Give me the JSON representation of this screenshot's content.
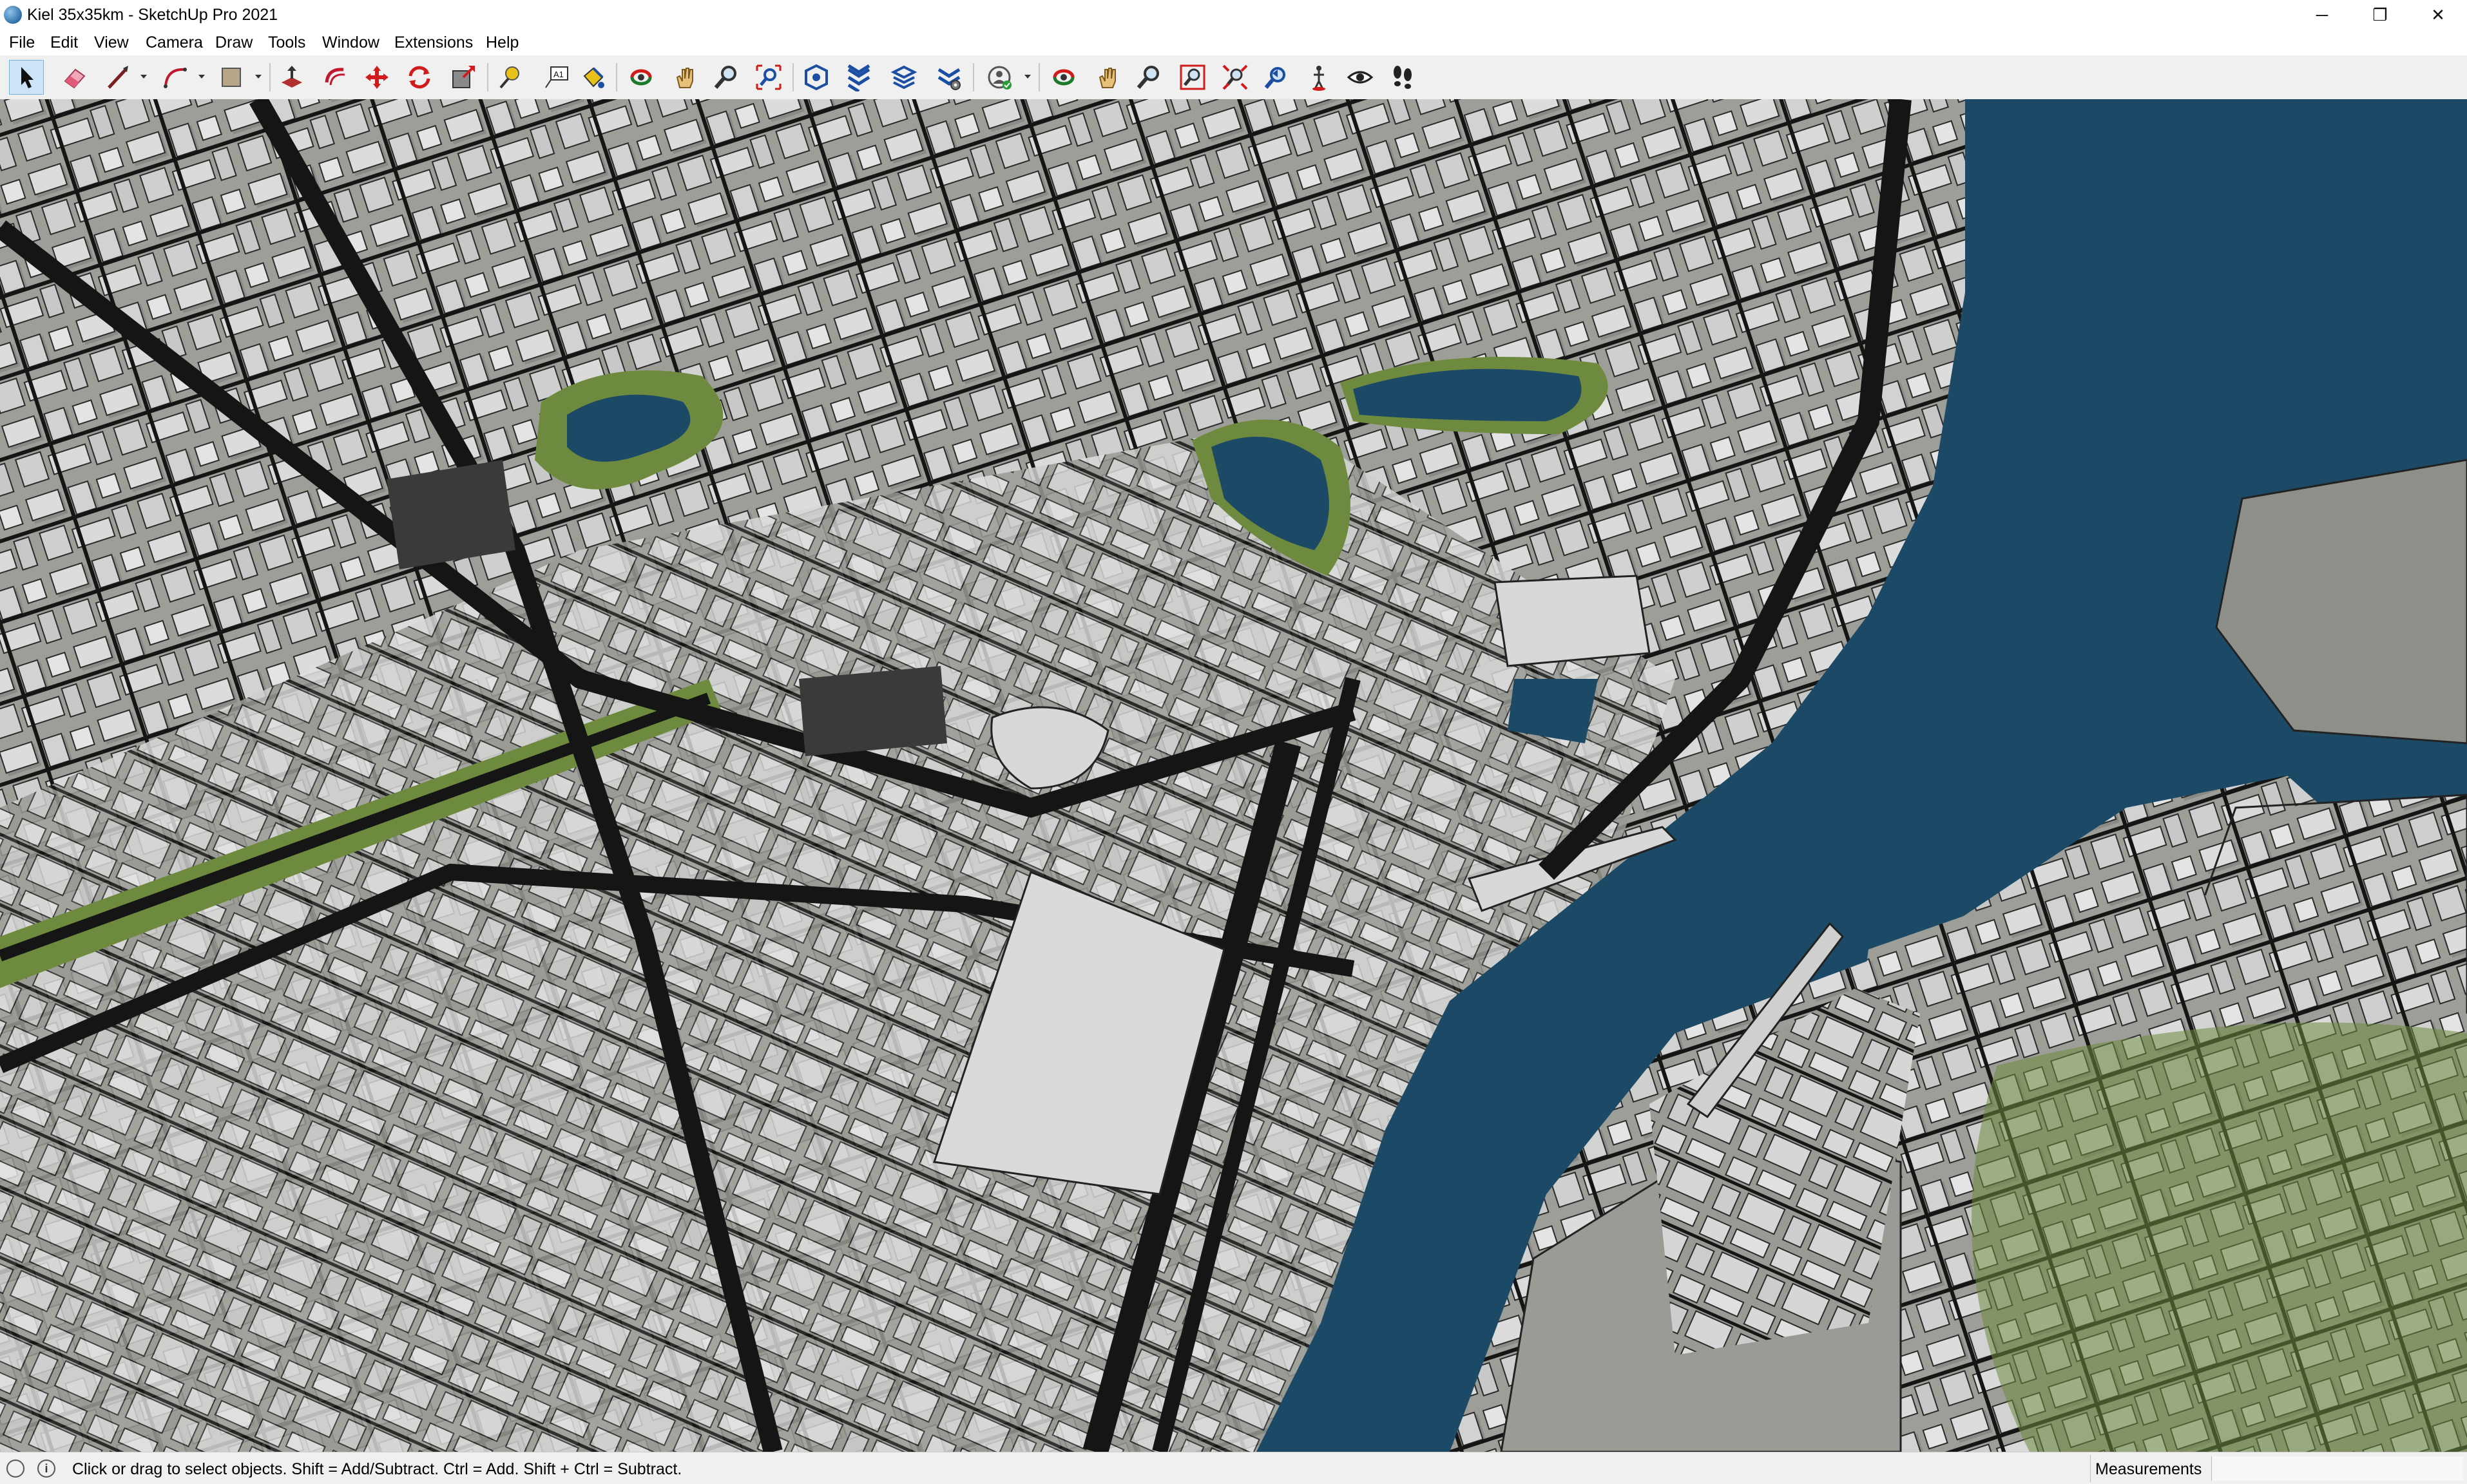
{
  "window": {
    "title": "Kiel 35x35km - SketchUp Pro 2021",
    "minimize_glyph": "─",
    "restore_glyph": "❐",
    "close_glyph": "✕"
  },
  "menu": [
    "File",
    "Edit",
    "View",
    "Camera",
    "Draw",
    "Tools",
    "Window",
    "Extensions",
    "Help"
  ],
  "toolbar": {
    "tools": [
      {
        "name": "select-tool-icon",
        "active": true
      },
      {
        "name": "eraser-tool-icon"
      },
      {
        "name": "line-tool-icon",
        "dropdown": true
      },
      {
        "name": "arc-tool-icon",
        "dropdown": true
      },
      {
        "name": "rectangle-tool-icon",
        "dropdown": true
      },
      {
        "name": "push-pull-tool-icon"
      },
      {
        "name": "offset-tool-icon"
      },
      {
        "name": "move-tool-icon"
      },
      {
        "name": "rotate-tool-icon"
      },
      {
        "name": "scale-tool-icon"
      },
      {
        "name": "tape-measure-tool-icon"
      },
      {
        "name": "text-tool-icon",
        "label": "A1"
      },
      {
        "name": "paint-bucket-tool-icon"
      },
      {
        "name": "orbit-tool-icon"
      },
      {
        "name": "pan-tool-icon"
      },
      {
        "name": "zoom-tool-icon"
      },
      {
        "name": "zoom-extents-tool-icon"
      },
      {
        "name": "3d-warehouse-icon"
      },
      {
        "name": "extension-warehouse-icon"
      },
      {
        "name": "layout-send-icon"
      },
      {
        "name": "extension-manager-icon"
      },
      {
        "name": "account-icon",
        "dropdown": true
      },
      {
        "name": "orbit-camera-icon"
      },
      {
        "name": "pan-camera-icon"
      },
      {
        "name": "zoom-camera-icon"
      },
      {
        "name": "zoom-window-icon"
      },
      {
        "name": "zoom-extents-camera-icon"
      },
      {
        "name": "previous-view-icon"
      },
      {
        "name": "position-camera-icon"
      },
      {
        "name": "look-around-icon"
      },
      {
        "name": "walk-icon"
      }
    ]
  },
  "scene": {
    "colors": {
      "water": "#1c4a66",
      "ground": "#9b9b95",
      "road": "#161616",
      "building_top": "#dcdcdc",
      "building_side": "#8a8a8a",
      "park": "#6d8a3e"
    }
  },
  "status": {
    "message": "Click or drag to select objects. Shift = Add/Subtract. Ctrl = Add. Shift + Ctrl = Subtract.",
    "measurements_label": "Measurements",
    "measurements_value": ""
  }
}
